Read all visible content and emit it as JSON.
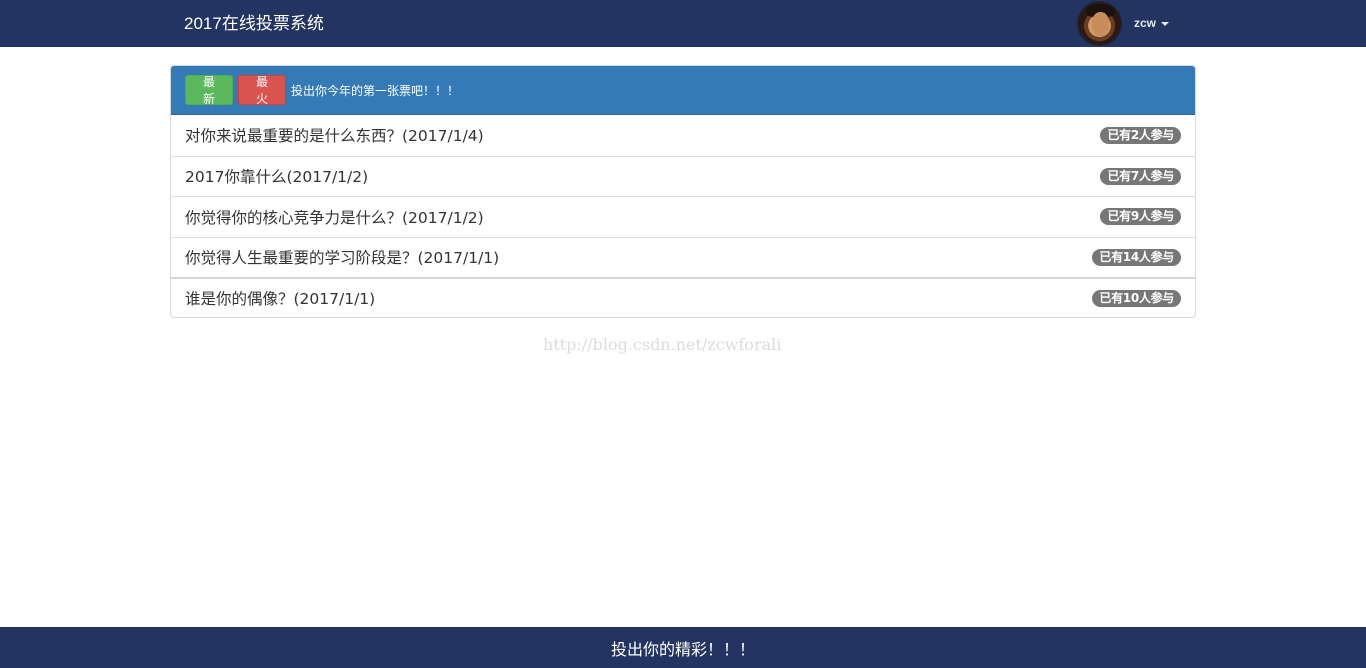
{
  "navbar": {
    "brand": "2017在线投票系统",
    "username": "zcw"
  },
  "panel": {
    "buttons": {
      "newest": "最新",
      "hottest": "最火"
    },
    "heading_text": "投出你今年的第一张票吧！！！",
    "items": [
      {
        "title": "对你来说最重要的是什么东西？(2017/1/4)",
        "badge": "已有2人参与"
      },
      {
        "title": "2017你靠什么(2017/1/2)",
        "badge": "已有7人参与"
      },
      {
        "title": "你觉得你的核心竞争力是什么？(2017/1/2)",
        "badge": "已有9人参与"
      },
      {
        "title": "你觉得人生最重要的学习阶段是？(2017/1/1)",
        "badge": "已有14人参与"
      },
      {
        "title": "谁是你的偶像？(2017/1/1)",
        "badge": "已有10人参与"
      }
    ]
  },
  "watermark": "http://blog.csdn.net/zcwforali",
  "footer": {
    "text": "投出你的精彩！！！"
  },
  "colors": {
    "navbar": "#233463",
    "panel_heading": "#337ab7",
    "btn_newest": "#5cb85c",
    "btn_hottest": "#d9534f",
    "badge": "#777777"
  }
}
